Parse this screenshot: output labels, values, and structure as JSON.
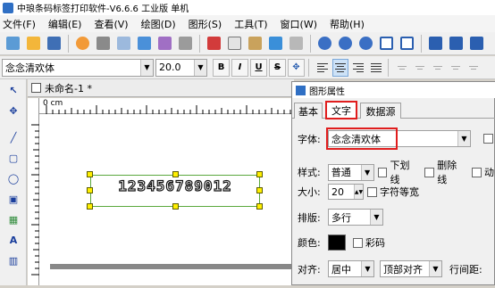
{
  "app": {
    "title": "中琅条码标签打印软件-V6.6.6 工业版 单机"
  },
  "menu": [
    "文件(F)",
    "编辑(E)",
    "查看(V)",
    "绘图(D)",
    "图形(S)",
    "工具(T)",
    "窗口(W)",
    "帮助(H)"
  ],
  "format_bar": {
    "font": "念念清欢体",
    "size": "20.0",
    "bold": "B",
    "italic": "I",
    "underline": "U",
    "strike": "S"
  },
  "document": {
    "tab": "未命名-1 *",
    "ruler_unit": "0 cm"
  },
  "canvas": {
    "barcode_text": "123456789012"
  },
  "dialog": {
    "title": "图形属性",
    "tabs": [
      "基本",
      "文字",
      "数据源"
    ],
    "font_label": "字体:",
    "font_value": "念念清欢体",
    "style_label": "样式:",
    "style_value": "普通",
    "underline": "下划线",
    "strike": "删除线",
    "move": "动",
    "size_label": "大小:",
    "size_value": "20",
    "equal_width": "字符等宽",
    "layout_label": "排版:",
    "layout_value": "多行",
    "color_label": "颜色:",
    "color_value": "#000000",
    "rainbow": "彩码",
    "align_label": "对齐:",
    "align_value": "居中",
    "valign_value": "顶部对齐",
    "line_spacing": "行间距:"
  },
  "colors": {
    "highlight": "#e01d1d",
    "selection_border": "#5aa83c",
    "handle": "#ffef00"
  }
}
